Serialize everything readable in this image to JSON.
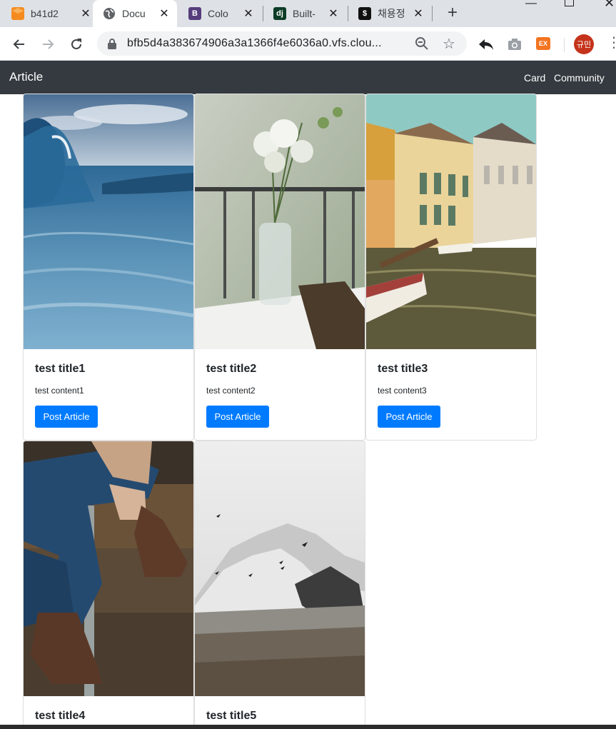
{
  "browser": {
    "tabs": [
      {
        "label": "b41d2",
        "favicon": "package-orange-icon"
      },
      {
        "label": "Docu",
        "favicon": "globe-icon"
      },
      {
        "label": "Colo",
        "favicon": "bootstrap-icon",
        "favicon_text": "B"
      },
      {
        "label": "Built-",
        "favicon": "django-icon",
        "favicon_text": "dj"
      },
      {
        "label": "채용정",
        "favicon": "dollar-app-icon"
      }
    ],
    "url": "bfb5d4a383674906a3a1366f4e6036a0.vfs.clou...",
    "ext_label": "EX",
    "profile_label": "규민"
  },
  "navbar": {
    "brand": "Article",
    "links": [
      "Card",
      "Community"
    ]
  },
  "cards": [
    {
      "title": "test title1",
      "content": "test content1",
      "button": "Post Article",
      "image": "ocean-wave"
    },
    {
      "title": "test title2",
      "content": "test content2",
      "button": "Post Article",
      "image": "flower-vase"
    },
    {
      "title": "test title3",
      "content": "test content3",
      "button": "Post Article",
      "image": "canal-town"
    },
    {
      "title": "test title4",
      "content": "",
      "button": "",
      "image": "jeans-boots"
    },
    {
      "title": "test title5",
      "content": "",
      "button": "",
      "image": "snowy-mountain"
    }
  ],
  "colors": {
    "navbar_bg": "#343a40",
    "button_bg": "#007bff",
    "tabbar_bg": "#dee1e6"
  }
}
